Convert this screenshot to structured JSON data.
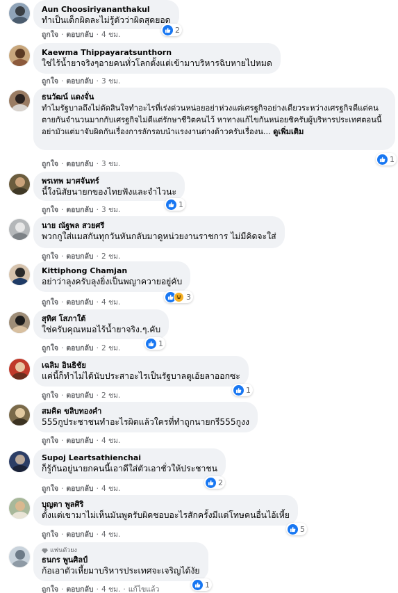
{
  "actions": {
    "like": "ถูกใจ",
    "reply": "ตอบกลับ",
    "edited": "แก้ไขแล้ว"
  },
  "colors": {
    "bubble": "#f0f2f5",
    "like_blue": "#1877f2",
    "meta_gray": "#65676b"
  },
  "comments": [
    {
      "author": "Aun Choosiriyananthakul",
      "text": "ทำเป็นเด็กผิดละไม่รู้ตัวว่าผิดสุดยอด",
      "time": "4 ชม.",
      "reactions": "2"
    },
    {
      "author": "Kaewma Thippayaratsunthorn",
      "text": "ใช่ไร้น้ำยาจริงๆอายคนทั่วโลกตั้งแต่เข้ามาบริหารฉิบหายไปหมด",
      "time": "3 ชม.",
      "reactions": ""
    },
    {
      "author": "ธนวัฒน์ แดงจั่น",
      "text": "ทำไมรัฐบาลถึงไม่ตัดสินใจทำอะไรที่เร่งด่วนหน่อยอย่าห่วงแต่เศรฐกิจอย่างเดียวระหว่างเศรฐกิจดีแต่คนตายกันจำนวนมากกับเศรฐกิจไม่ดีแต่รักษาชีวิตคนไว้ หาทางแก้ไขกันหน่อยซิครับผู้บริหารประเทศตอนนี้อย่ามัวแต่มาจับผิดกันเรื่องการลักรอบนำแรงงานต่างด้าวครับเรื่องน...",
      "more": "ดูเพิ่มเติม",
      "time": "3 ชม.",
      "reactions": "1"
    },
    {
      "author": "พรเทพ มาศจันทร์",
      "text": "นี้ใงนิสัยนายกของไทยฟังและจำไวนะ",
      "time": "3 ชม.",
      "reactions": "1"
    },
    {
      "author": "นาย ณัฐพล สวยศรี",
      "text": "พวกกูใส่แมสกันทุกวันหันกลับมาดูหน่วยงานราชการ ไม่มีคิดจะใส่",
      "time": "2 ชม.",
      "reactions": ""
    },
    {
      "author": "Kittiphong Chamjan",
      "text": "อย่าว่าลุงครับลุงยิ่งเป็นพญาควายอยู่คับ",
      "time": "4 ชม.",
      "reactions": "3"
    },
    {
      "author": "สุทิศ โสภาใต้",
      "text": "ใช่ครับคุณหมอไร้น้ำยาจริง.ๆ.คับ",
      "time": "2 ชม.",
      "reactions": "1"
    },
    {
      "author": "เฉลิม อินธิชัย",
      "text": "แค่นี้ก็ทำไม่ได้นับประสาอะไรเป็นรัฐบาลตูเอ้ยลาออกซะ",
      "time": "2 ชม.",
      "reactions": "1"
    },
    {
      "author": "สมคิด ขลิบทองคำ",
      "text": "555กูประชาชนทำอะไรผิดแล้วใครที่ทำถูกนายกรี555กูงง",
      "time": "4 ชม.",
      "reactions": ""
    },
    {
      "author": "Supoj Leartsathienchai",
      "text": "ก็รู้กันอยู่นายกคนนี้เอาดีใส่ตัวเอาชั่วให้ประชาชน",
      "time": "4 ชม.",
      "reactions": "2"
    },
    {
      "author": "บุญตา พูลศิริ",
      "text": "ตั้งแต่เขามาไม่เห็นมันพูดรับผิดชอบอะไรสักครั้งมีแต่โทษคนอื่นไอ้เหี้ย",
      "time": "4 ชม.",
      "reactions": "5"
    },
    {
      "badge": "แฟนตัวยง",
      "author": "ธนกร พูนศิลป์",
      "text": "ก้อเอาตัวเหี้ยมาบริหารประเทศจะเจริญได้งัย",
      "time": "4 ชม.",
      "reactions": "1",
      "edited": true
    }
  ]
}
